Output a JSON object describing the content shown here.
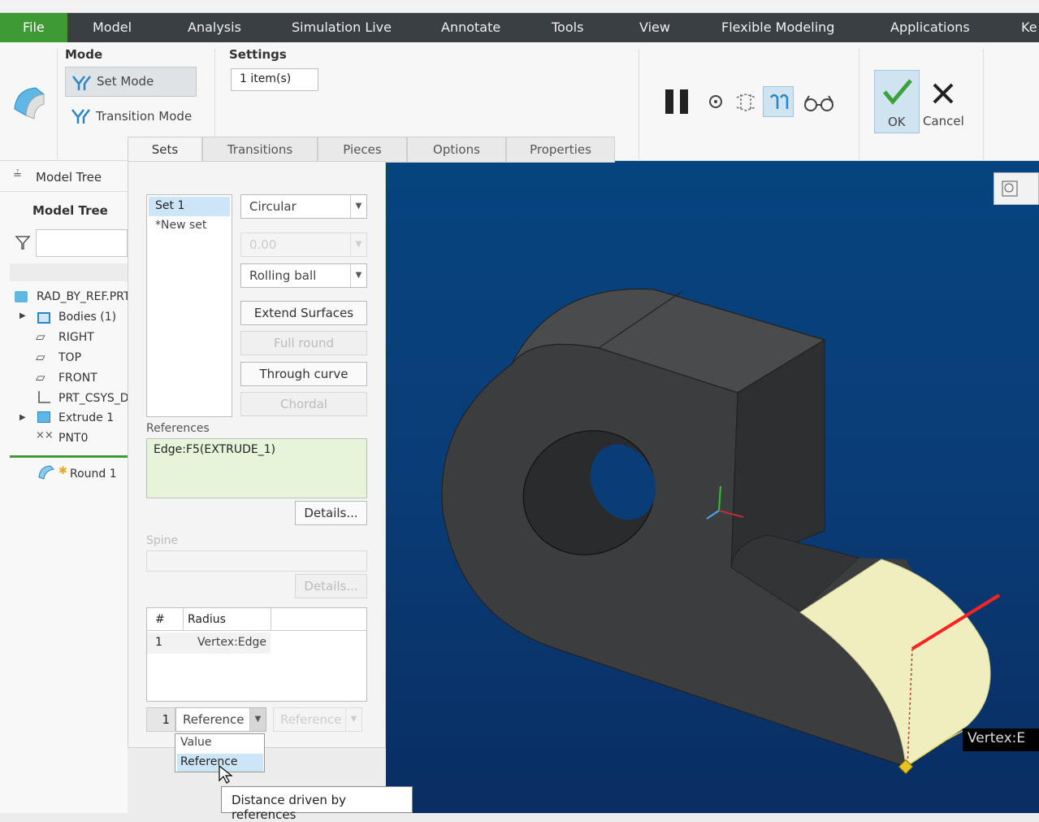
{
  "menubar": {
    "file": "File",
    "items": [
      "Model",
      "Analysis",
      "Simulation Live",
      "Annotate",
      "Tools",
      "View",
      "Flexible Modeling",
      "Applications",
      "Ke"
    ]
  },
  "ribbon": {
    "mode_label": "Mode",
    "set_mode": "Set Mode",
    "transition_mode": "Transition Mode",
    "settings_label": "Settings",
    "settings_value": "1 item(s)",
    "ok": "OK",
    "cancel": "Cancel"
  },
  "tabs": [
    "Sets",
    "Transitions",
    "Pieces",
    "Options",
    "Properties"
  ],
  "tree": {
    "tab_label": "Model Tree",
    "header": "Model Tree",
    "items": [
      "RAD_BY_REF.PRT",
      "Bodies (1)",
      "RIGHT",
      "TOP",
      "FRONT",
      "PRT_CSYS_DEF",
      "Extrude 1",
      "PNT0"
    ],
    "insert_item": "Round 1"
  },
  "sets_panel": {
    "sets": [
      "Set 1",
      "*New set"
    ],
    "shape": "Circular",
    "value_field": "0.00",
    "method": "Rolling ball",
    "buttons": {
      "extend_surfaces": "Extend Surfaces",
      "full_round": "Full round",
      "through_curve": "Through curve",
      "chordal": "Chordal"
    },
    "references_label": "References",
    "references_value": "Edge:F5(EXTRUDE_1)",
    "details": "Details...",
    "spine_label": "Spine",
    "spine_details": "Details...",
    "radius_table": {
      "col_hash": "#",
      "col_radius": "Radius",
      "rows": [
        {
          "n": "1",
          "value": "Vertex:Edge"
        }
      ]
    },
    "bottom_num": "1",
    "bottom_dd": "Reference",
    "bottom_dd2": "Reference",
    "dropdown_options": [
      "Value",
      "Reference"
    ]
  },
  "tooltip": "Distance driven by references",
  "viewport": {
    "vertex_label": "Vertex:E"
  },
  "colors": {
    "menubar": "#3a3f44",
    "file_tab": "#3d9a35",
    "viewport_bg": "#0a3d78",
    "model_body": "#3c3d3f",
    "round_surface": "#efeebe",
    "references_bg": "#e6f5d9",
    "selection": "#cde6f7"
  }
}
